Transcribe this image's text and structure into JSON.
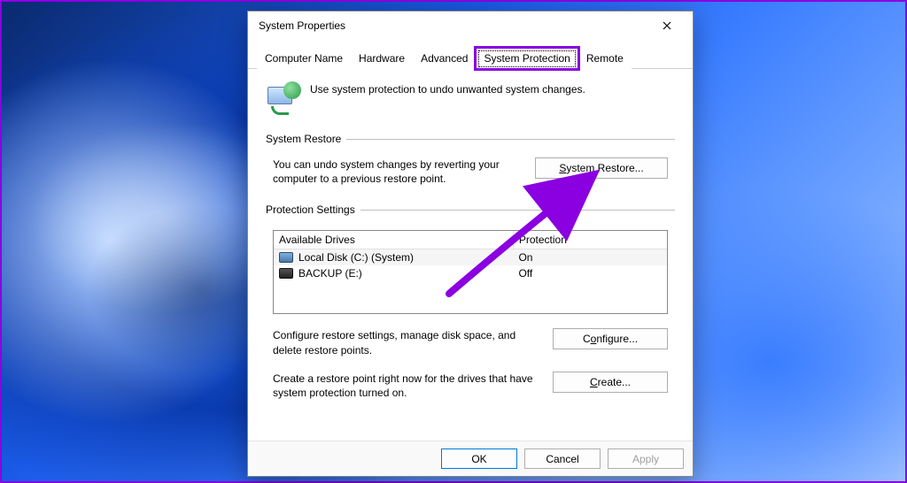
{
  "window": {
    "title": "System Properties"
  },
  "tabs": [
    {
      "label": "Computer Name"
    },
    {
      "label": "Hardware"
    },
    {
      "label": "Advanced"
    },
    {
      "label": "System Protection",
      "active": true,
      "highlighted": true
    },
    {
      "label": "Remote"
    }
  ],
  "intro": "Use system protection to undo unwanted system changes.",
  "restore_group": {
    "legend": "System Restore",
    "desc": "You can undo system changes by reverting your computer to a previous restore point.",
    "button_pre": "",
    "button_mn": "S",
    "button_post": "ystem Restore..."
  },
  "settings_group": {
    "legend": "Protection Settings",
    "header_drives": "Available Drives",
    "header_protection": "Protection",
    "drives": [
      {
        "name": "Local Disk (C:) (System)",
        "protection": "On",
        "icon": "light",
        "selected": true
      },
      {
        "name": "BACKUP (E:)",
        "protection": "Off",
        "icon": "dark",
        "selected": false
      }
    ],
    "configure": {
      "desc": "Configure restore settings, manage disk space, and delete restore points.",
      "button_pre": "C",
      "button_mn": "o",
      "button_post": "nfigure..."
    },
    "create": {
      "desc": "Create a restore point right now for the drives that have system protection turned on.",
      "button_pre": "",
      "button_mn": "C",
      "button_post": "reate..."
    }
  },
  "buttons": {
    "ok": "OK",
    "cancel": "Cancel",
    "apply": "Apply"
  }
}
